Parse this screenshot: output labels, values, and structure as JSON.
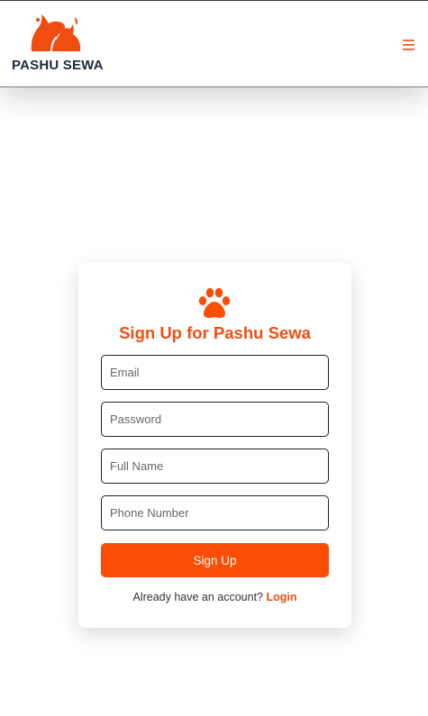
{
  "header": {
    "brand_name": "PASHU SEWA",
    "logo_icon": "dog-cat-silhouette-logo",
    "menu_icon": "hamburger-menu-icon"
  },
  "signup_card": {
    "icon": "paw-icon",
    "title": "Sign Up for Pashu Sewa",
    "fields": [
      {
        "name": "email",
        "value": "",
        "placeholder": "Email"
      },
      {
        "name": "password",
        "value": "",
        "placeholder": "Password"
      },
      {
        "name": "full_name",
        "value": "",
        "placeholder": "Full Name"
      },
      {
        "name": "phone_number",
        "value": "",
        "placeholder": "Phone Number"
      }
    ],
    "submit_label": "Sign Up",
    "login_prompt": "Already have an account?",
    "login_link": "Login"
  },
  "colors": {
    "accent": "#fb4d04",
    "title": "#f04e10",
    "brand_text": "#1e2a3a"
  }
}
